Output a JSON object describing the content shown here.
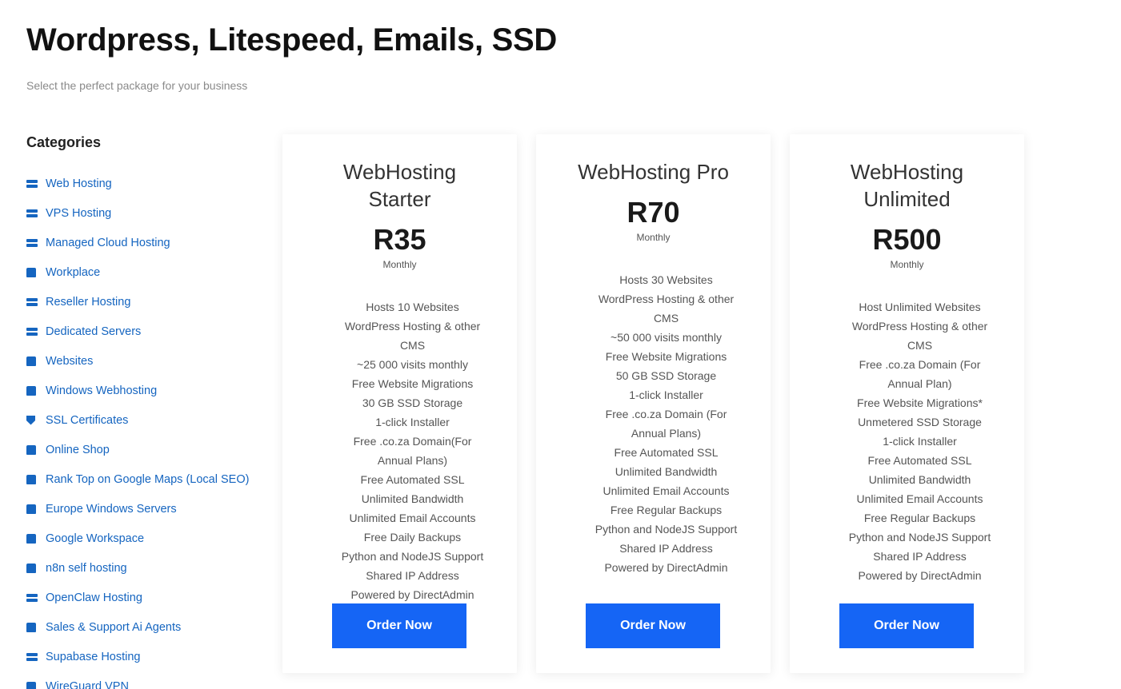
{
  "header": {
    "title": "Wordpress, Litespeed, Emails, SSD",
    "subtitle": "Select the perfect package for your business"
  },
  "sidebar": {
    "heading": "Categories",
    "items": [
      {
        "label": "Web Hosting",
        "icon": "server-icon"
      },
      {
        "label": "VPS Hosting",
        "icon": "server-icon"
      },
      {
        "label": "Managed Cloud Hosting",
        "icon": "server-icon"
      },
      {
        "label": "Workplace",
        "icon": "box-icon"
      },
      {
        "label": "Reseller Hosting",
        "icon": "server-icon"
      },
      {
        "label": "Dedicated Servers",
        "icon": "server-icon"
      },
      {
        "label": "Websites",
        "icon": "box-icon"
      },
      {
        "label": "Windows Webhosting",
        "icon": "box-icon"
      },
      {
        "label": "SSL Certificates",
        "icon": "shield-icon"
      },
      {
        "label": "Online Shop",
        "icon": "box-icon"
      },
      {
        "label": "Rank Top on Google Maps (Local SEO)",
        "icon": "box-icon"
      },
      {
        "label": "Europe Windows Servers",
        "icon": "box-icon"
      },
      {
        "label": "Google Workspace",
        "icon": "box-icon"
      },
      {
        "label": "n8n self hosting",
        "icon": "box-icon"
      },
      {
        "label": "OpenClaw Hosting",
        "icon": "server-icon"
      },
      {
        "label": "Sales & Support Ai Agents",
        "icon": "box-icon"
      },
      {
        "label": "Supabase Hosting",
        "icon": "server-icon"
      },
      {
        "label": "WireGuard VPN",
        "icon": "box-icon"
      }
    ]
  },
  "plans": [
    {
      "name": "WebHosting Starter",
      "price": "R35",
      "period": "Monthly",
      "features": [
        "Hosts 10 Websites",
        "WordPress Hosting & other CMS",
        "~25 000 visits monthly",
        "Free Website Migrations",
        "30 GB SSD Storage",
        "1-click Installer",
        "Free .co.za Domain(For Annual Plans)",
        "Free Automated SSL",
        "Unlimited Bandwidth",
        "Unlimited Email Accounts",
        "Free Daily Backups",
        "Python and NodeJS Support",
        "Shared IP Address",
        "Powered by DirectAdmin"
      ],
      "button": "Order Now"
    },
    {
      "name": "WebHosting Pro",
      "price": "R70",
      "period": "Monthly",
      "features": [
        "Hosts 30 Websites",
        "WordPress Hosting & other CMS",
        "~50 000 visits monthly",
        "Free Website Migrations",
        "50 GB SSD Storage",
        "1-click Installer",
        "Free .co.za Domain (For Annual Plans)",
        "Free Automated SSL",
        "Unlimited Bandwidth",
        "Unlimited Email Accounts",
        "Free Regular Backups",
        "Python and NodeJS Support",
        "Shared IP Address",
        "Powered by DirectAdmin"
      ],
      "button": "Order Now"
    },
    {
      "name": "WebHosting Unlimited",
      "price": "R500",
      "period": "Monthly",
      "features": [
        "Host Unlimited Websites",
        "WordPress Hosting & other CMS",
        "Free .co.za Domain (For Annual Plan)",
        "Free Website Migrations*",
        "Unmetered SSD Storage",
        "1-click Installer",
        "Free Automated SSL",
        "Unlimited Bandwidth",
        "Unlimited Email Accounts",
        "Free Regular Backups",
        "Python and NodeJS Support",
        "Shared IP Address",
        "Powered by DirectAdmin"
      ],
      "button": "Order Now"
    }
  ],
  "colors": {
    "accent": "#1565f5",
    "link": "#1565c0",
    "title": "#111111",
    "muted": "#8a8a8a"
  }
}
